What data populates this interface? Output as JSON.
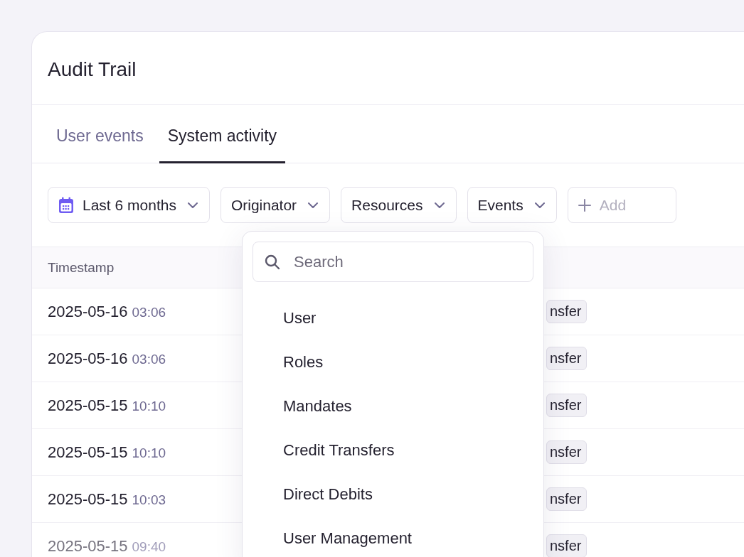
{
  "page": {
    "title": "Audit Trail"
  },
  "tabs": [
    {
      "label": "User events",
      "selected": false
    },
    {
      "label": "System activity",
      "selected": true
    }
  ],
  "filters": [
    {
      "label": "Last 6 months",
      "kind": "date"
    },
    {
      "label": "Originator",
      "kind": "dropdown"
    },
    {
      "label": "Resources",
      "kind": "dropdown"
    },
    {
      "label": "Events",
      "kind": "dropdown"
    },
    {
      "label": "Add",
      "kind": "add"
    }
  ],
  "table": {
    "columns": [
      "Timestamp"
    ],
    "rows": [
      {
        "date": "2025-05-16",
        "time": "03:06",
        "tag": "nsfer"
      },
      {
        "date": "2025-05-16",
        "time": "03:06",
        "tag": "nsfer"
      },
      {
        "date": "2025-05-15",
        "time": "10:10",
        "tag": "nsfer"
      },
      {
        "date": "2025-05-15",
        "time": "10:10",
        "tag": "nsfer"
      },
      {
        "date": "2025-05-15",
        "time": "10:03",
        "tag": "nsfer"
      },
      {
        "date": "2025-05-15",
        "time": "09:40",
        "tag": "nsfer"
      }
    ]
  },
  "dropdown": {
    "search": {
      "placeholder": "Search"
    },
    "options": [
      "User",
      "Roles",
      "Mandates",
      "Credit Transfers",
      "Direct Debits",
      "User Management"
    ]
  }
}
